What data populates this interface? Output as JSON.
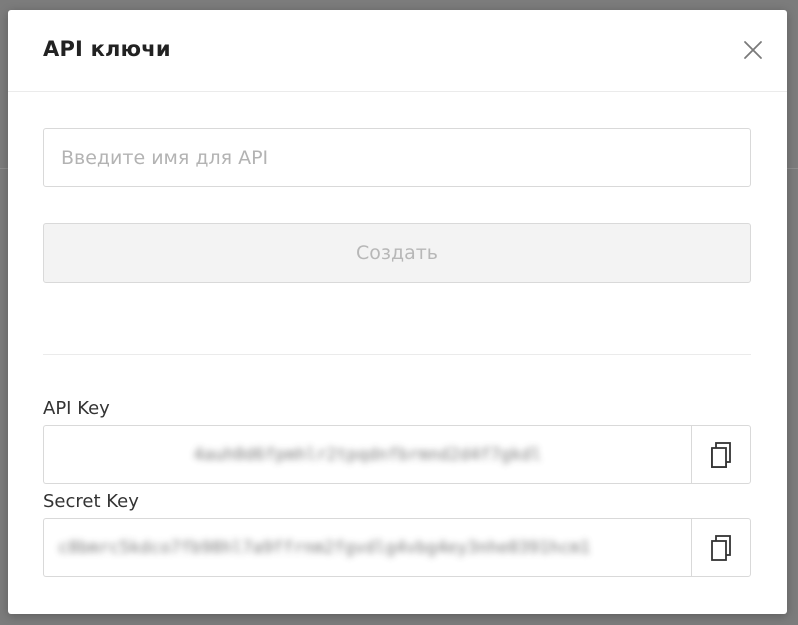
{
  "modal": {
    "title": "API ключи",
    "close_icon": "close-icon"
  },
  "create_form": {
    "name_input": {
      "value": "",
      "placeholder": "Введите имя для API"
    },
    "create_button_label": "Создать",
    "create_button_disabled": true
  },
  "api_key": {
    "label": "API Key",
    "value": "4auh0d6fpmhlr2tpqdnfbrmnd2d4f7gkdl",
    "copy_icon": "copy-icon"
  },
  "secret_key": {
    "label": "Secret Key",
    "value": "c8bmrc5kdco7fb98hl7a9ffrnm2fgvdlg4vbg4ey3nhe0391hcm1",
    "copy_icon": "copy-icon"
  },
  "colors": {
    "overlay": "#7c7c7c",
    "border": "#d9d9d9",
    "disabled_bg": "#f3f3f3",
    "disabled_text": "#b7b7b7",
    "title_text": "#222222"
  }
}
